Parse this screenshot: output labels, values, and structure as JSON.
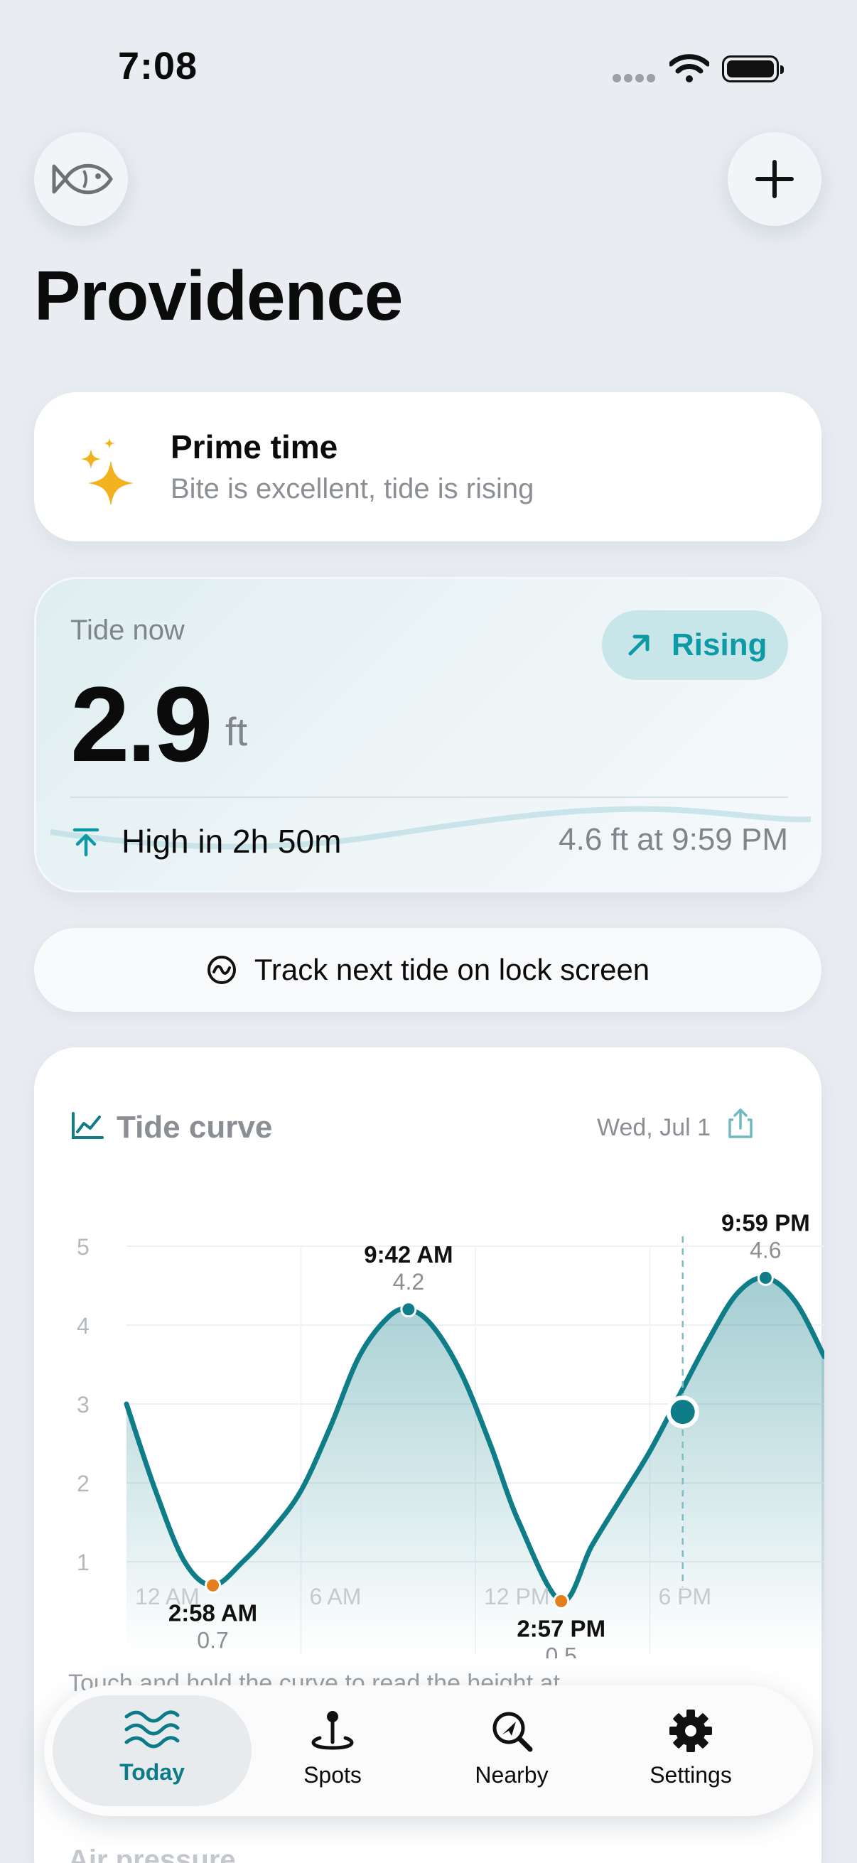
{
  "status": {
    "time": "7:08"
  },
  "title": "Providence",
  "prime": {
    "title": "Prime time",
    "subtitle": "Bite is excellent, tide is rising"
  },
  "tide_now": {
    "label": "Tide now",
    "value": "2.9",
    "unit": "ft",
    "trend": "Rising",
    "next": "High in 2h 50m",
    "next_detail": "4.6 ft at 9:59 PM"
  },
  "track_button": "Track next tide on lock screen",
  "tide_curve": {
    "title": "Tide curve",
    "date": "Wed, Jul 1",
    "hint": "Touch and hold the curve to read the height at"
  },
  "chart_data": {
    "type": "area",
    "title": "Tide curve",
    "x_tick_labels": [
      "12 AM",
      "6 AM",
      "12 PM",
      "6 PM"
    ],
    "y_ticks": [
      1,
      2,
      3,
      4,
      5
    ],
    "ylim": [
      0,
      5
    ],
    "xlim_hours": [
      0,
      24
    ],
    "grid": true,
    "curve_x_hours": [
      0.0,
      1.0,
      2.0,
      2.97,
      4.0,
      5.0,
      6.0,
      7.0,
      8.0,
      9.0,
      9.7,
      10.5,
      11.5,
      12.5,
      13.5,
      14.95,
      16.0,
      17.0,
      18.0,
      19.0,
      20.0,
      21.0,
      21.98,
      23.0,
      24.0
    ],
    "curve_y_ft": [
      3.0,
      1.9,
      1.0,
      0.7,
      1.0,
      1.4,
      1.9,
      2.7,
      3.6,
      4.1,
      4.2,
      4.0,
      3.4,
      2.5,
      1.5,
      0.5,
      1.2,
      1.8,
      2.4,
      3.1,
      3.8,
      4.4,
      4.6,
      4.3,
      3.6
    ],
    "extremes": [
      {
        "time": "2:58 AM",
        "height": "0.7",
        "hour": 2.97,
        "ft": 0.7,
        "kind": "low"
      },
      {
        "time": "9:42 AM",
        "height": "4.2",
        "hour": 9.7,
        "ft": 4.2,
        "kind": "high"
      },
      {
        "time": "2:57 PM",
        "height": "0.5",
        "hour": 14.95,
        "ft": 0.5,
        "kind": "low"
      },
      {
        "time": "9:59 PM",
        "height": "4.6",
        "hour": 21.98,
        "ft": 4.6,
        "kind": "high"
      }
    ],
    "now": {
      "hour": 19.13,
      "ft": 2.9
    }
  },
  "tabs": [
    {
      "label": "Today",
      "icon": "waves-icon",
      "active": true
    },
    {
      "label": "Spots",
      "icon": "pin-icon",
      "active": false
    },
    {
      "label": "Nearby",
      "icon": "search-location-icon",
      "active": false
    },
    {
      "label": "Settings",
      "icon": "gear-icon",
      "active": false
    }
  ],
  "peek": {
    "label": "Air pressure"
  },
  "colors": {
    "accent": "#0e7d88",
    "low_marker": "#e57e1c",
    "rising": "#0e9aa5",
    "star": "#f2b21f"
  }
}
